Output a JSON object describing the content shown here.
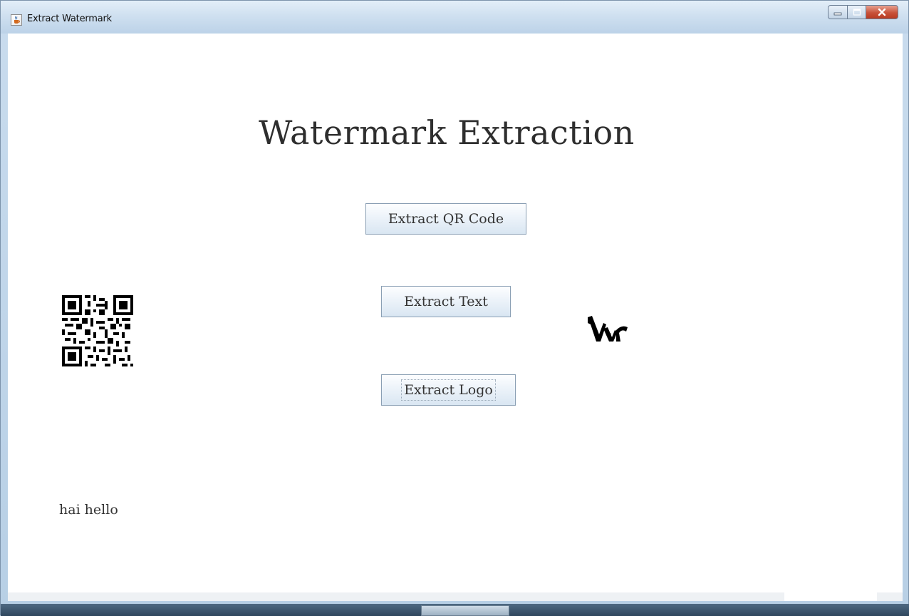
{
  "window": {
    "title": "Extract Watermark",
    "app_icon": "java-cup-icon",
    "controls": [
      "minimize-icon",
      "maximize-icon",
      "close-icon"
    ]
  },
  "main": {
    "heading": "Watermark Extraction",
    "buttons": {
      "extract_qr": "Extract QR Code",
      "extract_text": "Extract Text",
      "extract_logo": "Extract Logo"
    },
    "outputs": {
      "qr_image": "qr-code-image",
      "logo_image": "extracted-logo-image",
      "text_value": "hai hello"
    }
  },
  "colors": {
    "titlebar": "#cfe0f0",
    "client_bg": "#ffffff",
    "close_button": "#c8523a",
    "button_border": "#8a9fb4"
  }
}
